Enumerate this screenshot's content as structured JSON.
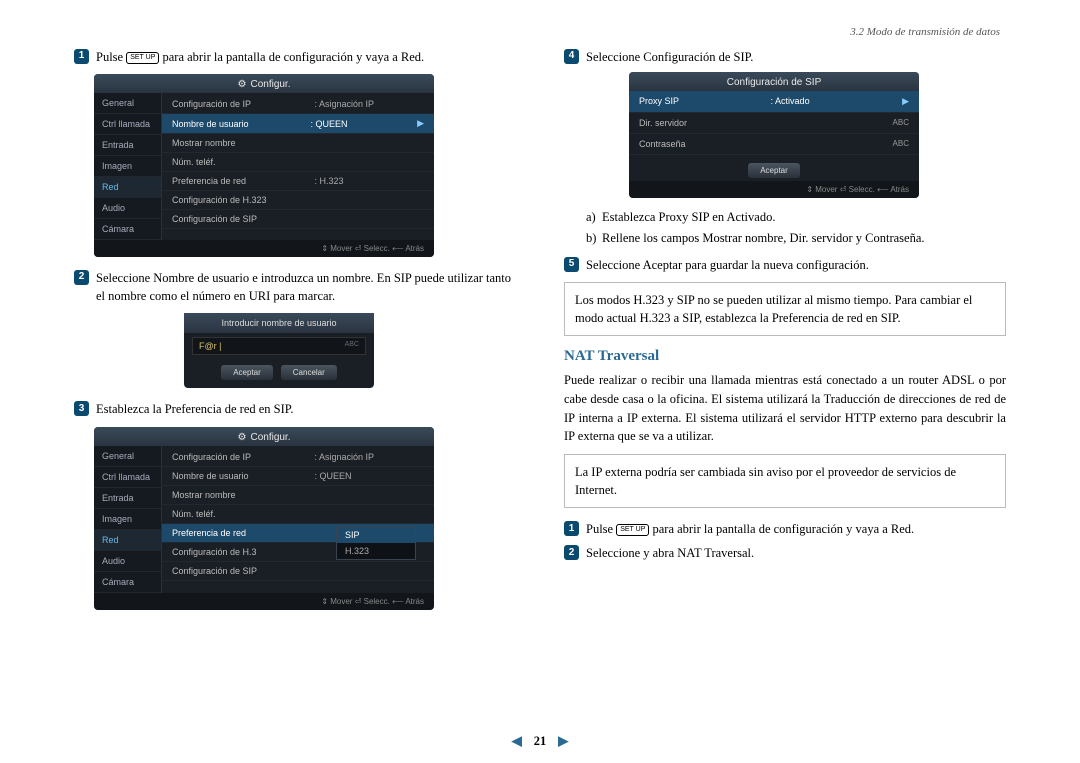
{
  "header": {
    "section": "3.2 Modo de transmisión de datos"
  },
  "left": {
    "step1": {
      "pre": "Pulse ",
      "key": "SET UP",
      "post": " para abrir la pantalla de configuración y vaya a Red."
    },
    "shot1": {
      "title": "Configur.",
      "side": [
        "General",
        "Ctrl llamada",
        "Entrada",
        "Imagen",
        "Red",
        "Audio",
        "Cámara"
      ],
      "side_sel": "Red",
      "rows": [
        {
          "k": "Configuración de IP",
          "v": ": Asignación IP"
        },
        {
          "k": "Nombre de usuario",
          "v": ": QUEEN",
          "hl": true
        },
        {
          "k": "Mostrar nombre",
          "v": ""
        },
        {
          "k": "Núm. teléf.",
          "v": ""
        },
        {
          "k": "Preferencia de red",
          "v": ": H.323"
        },
        {
          "k": "Configuración de H.323",
          "v": ""
        },
        {
          "k": "Configuración de SIP",
          "v": ""
        }
      ],
      "foot": "⇕ Mover   ⏎ Selecc.  ⟵ Atrás"
    },
    "step2": "Seleccione Nombre de usuario e introduzca un nombre. En SIP puede utilizar tanto el nombre como el número en URI para marcar.",
    "mini": {
      "title": "Introducir nombre de usuario",
      "value": "F@r |",
      "abc": "ABC",
      "btn_ok": "Aceptar",
      "btn_cancel": "Cancelar"
    },
    "step3": "Establezca la Preferencia de red en SIP.",
    "shot3": {
      "title": "Configur.",
      "rows": [
        {
          "k": "Configuración de IP",
          "v": ": Asignación IP"
        },
        {
          "k": "Nombre de usuario",
          "v": ": QUEEN"
        },
        {
          "k": "Mostrar nombre",
          "v": ""
        },
        {
          "k": "Núm. teléf.",
          "v": ""
        },
        {
          "k": "Preferencia de red",
          "v": "",
          "hl": true
        },
        {
          "k": "Configuración de H.3",
          "v": ""
        },
        {
          "k": "Configuración de SIP",
          "v": ""
        }
      ],
      "dropdown": {
        "sel": "SIP",
        "other": "H.323"
      }
    }
  },
  "right": {
    "step4": "Seleccione Configuración de SIP.",
    "sip": {
      "title": "Configuración de SIP",
      "rows": [
        {
          "k": "Proxy SIP",
          "v": ": Activado",
          "hl": true,
          "arrow": true
        },
        {
          "k": "Dir. servidor",
          "v": "ABC"
        },
        {
          "k": "Contraseña",
          "v": "ABC"
        }
      ],
      "btn": "Aceptar",
      "foot": "⇕ Mover   ⏎ Selecc.  ⟵ Atrás"
    },
    "sub_a": "Establezca Proxy SIP en Activado.",
    "sub_b": "Rellene los campos Mostrar nombre, Dir. servidor y Contraseña.",
    "step5": "Seleccione Aceptar para guardar la nueva configuración.",
    "note1": "Los modos H.323 y SIP no se pueden utilizar al mismo tiempo. Para cambiar el modo actual H.323 a SIP, establezca la Preferencia de red en SIP.",
    "heading": "NAT Traversal",
    "body": "Puede realizar o recibir una llamada mientras está conectado a un router ADSL o por cabe desde casa o la oficina. El sistema utilizará la Traducción de direcciones de red de IP interna a IP externa. El sistema utilizará el servidor HTTP externo para descubrir la IP externa que se va a utilizar.",
    "note2": "La IP externa podría ser cambiada sin aviso por el proveedor de servicios de Internet.",
    "step1b": {
      "pre": "Pulse ",
      "key": "SET UP",
      "post": " para abrir la pantalla de configuración y vaya a Red."
    },
    "step2b": "Seleccione y abra NAT Traversal."
  },
  "pager": {
    "page": "21"
  }
}
